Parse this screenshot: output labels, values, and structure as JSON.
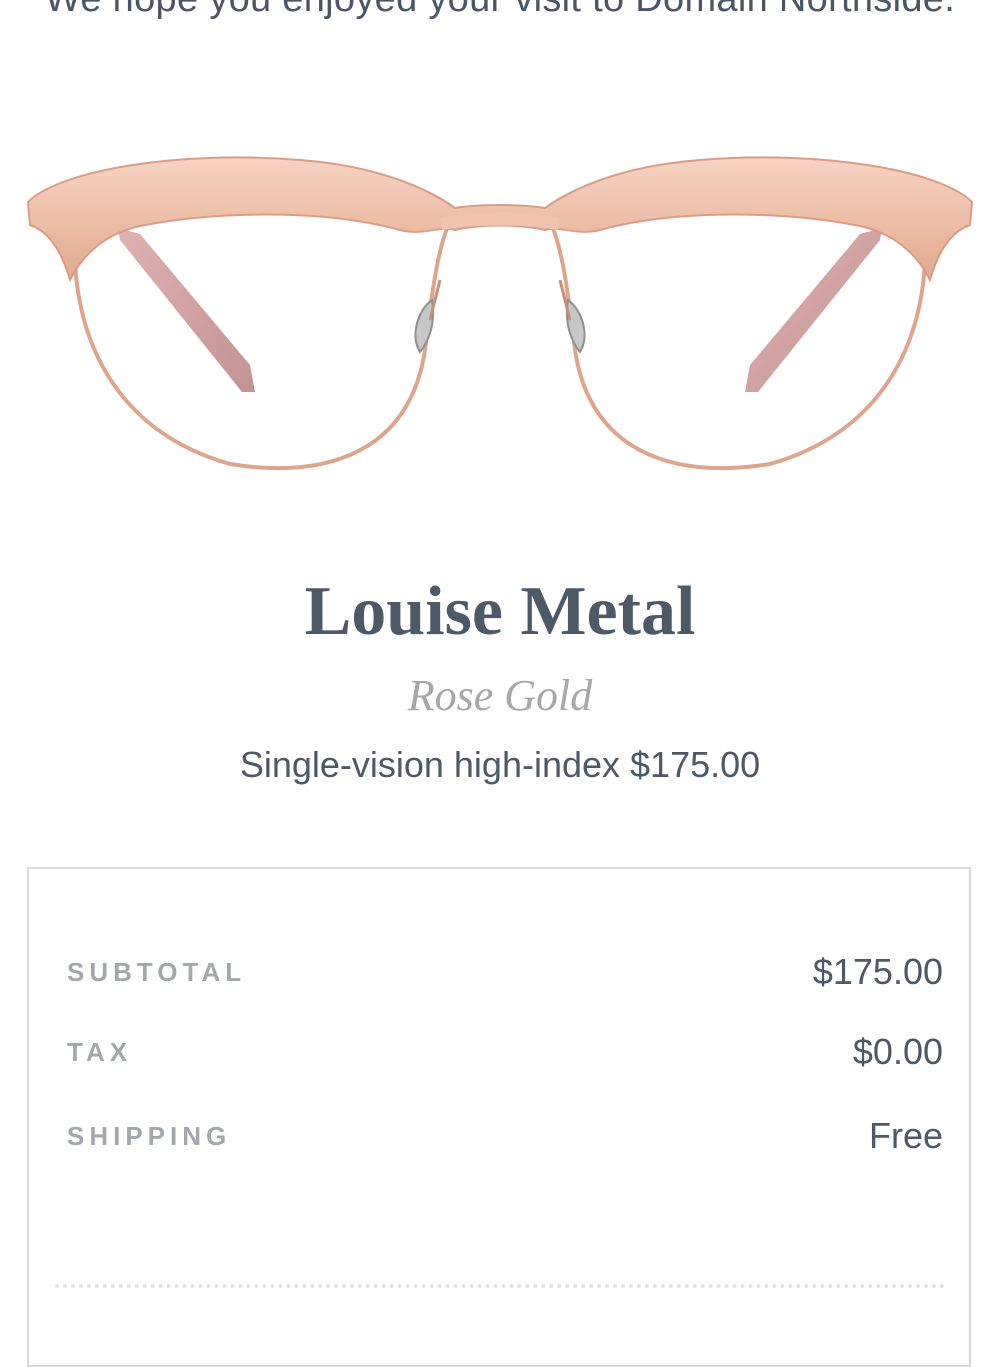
{
  "header": {
    "message": "We hope you enjoyed your visit to Domain Northside."
  },
  "product": {
    "image_alt": "eyeglasses-image",
    "name": "Louise Metal",
    "color": "Rose Gold",
    "lens": "Single-vision high-index $175.00",
    "frame_color": "#e8b8a2"
  },
  "summary": {
    "subtotal_label": "SUBTOTAL",
    "subtotal_value": "$175.00",
    "tax_label": "TAX",
    "tax_value": "$0.00",
    "shipping_label": "SHIPPING",
    "shipping_value": "Free"
  }
}
